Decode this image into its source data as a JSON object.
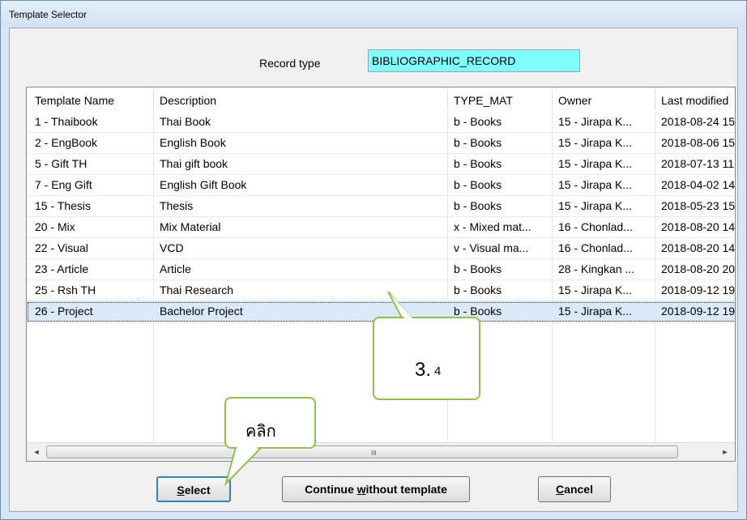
{
  "window": {
    "title": "Template Selector"
  },
  "record_type": {
    "label": "Record type",
    "value": "BIBLIOGRAPHIC_RECORD"
  },
  "table": {
    "headers": [
      "Template Name",
      "Description",
      "TYPE_MAT",
      "Owner",
      "Last modified"
    ],
    "rows": [
      [
        "1 - Thaibook",
        "Thai Book",
        "b - Books",
        "15 - Jirapa K...",
        "2018-08-24 15"
      ],
      [
        "2 - EngBook",
        "English Book",
        "b - Books",
        "15 - Jirapa K...",
        "2018-08-06 15"
      ],
      [
        "5 - Gift TH",
        "Thai gift book",
        "b - Books",
        "15 - Jirapa K...",
        "2018-07-13 11"
      ],
      [
        "7 - Eng Gift",
        "English Gift Book",
        "b - Books",
        "15 - Jirapa K...",
        "2018-04-02 14"
      ],
      [
        "15 - Thesis",
        "Thesis",
        "b - Books",
        "15 - Jirapa K...",
        "2018-05-23 15"
      ],
      [
        "20 - Mix",
        "Mix Material",
        "x - Mixed mat...",
        "16 - Chonlad...",
        "2018-08-20 14"
      ],
      [
        "22 - Visual",
        "VCD",
        "v - Visual ma...",
        "16 - Chonlad...",
        "2018-08-20 14"
      ],
      [
        "23 - Article",
        "Article",
        "b - Books",
        "28 - Kingkan ...",
        "2018-08-20 20"
      ],
      [
        "25 - Rsh TH",
        "Thai Research",
        "b - Books",
        "15 - Jirapa K...",
        "2018-09-12 19"
      ],
      [
        "26 - Project",
        "Bachelor Project",
        "b - Books",
        "15 - Jirapa K...",
        "2018-09-12 19"
      ]
    ],
    "selected_row": 10
  },
  "scrollbar": {
    "left_arrow": "◄",
    "right_arrow": "►",
    "grip": "III"
  },
  "buttons": {
    "select": {
      "underlined": "S",
      "rest": "elect"
    },
    "continue": {
      "before": "Continue ",
      "underlined": "w",
      "after": "ithout template"
    },
    "cancel": {
      "underlined": "C",
      "rest": "ancel"
    }
  },
  "callouts": {
    "step": {
      "main": "3.",
      "sub": "4"
    },
    "click": "คลิก"
  },
  "colors": {
    "record_type_bg": "#80ffff",
    "callout_border": "#8fc04f",
    "selected_row_bg": "#dbe8f8"
  }
}
